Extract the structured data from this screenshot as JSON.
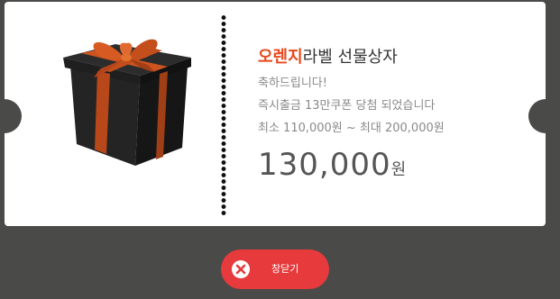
{
  "ticket": {
    "title_brand": "오렌지",
    "title_rest": "라벨 선물상자",
    "congrats": "축하드립니다!",
    "detail": "즉시출금 13만쿠폰 당첨 되었습니다",
    "range": "최소 110,000원 ~ 최대 200,000원",
    "amount": "130,000",
    "amount_unit": "원"
  },
  "close_button": {
    "label": "창닫기"
  },
  "colors": {
    "accent": "#e8481c",
    "button": "#e63a3d",
    "backdrop": "#4a4a48",
    "gift_box": "#1c1c1c",
    "ribbon": "#c9521a"
  },
  "icons": {
    "gift": "gift-box-icon",
    "close": "close-icon"
  }
}
